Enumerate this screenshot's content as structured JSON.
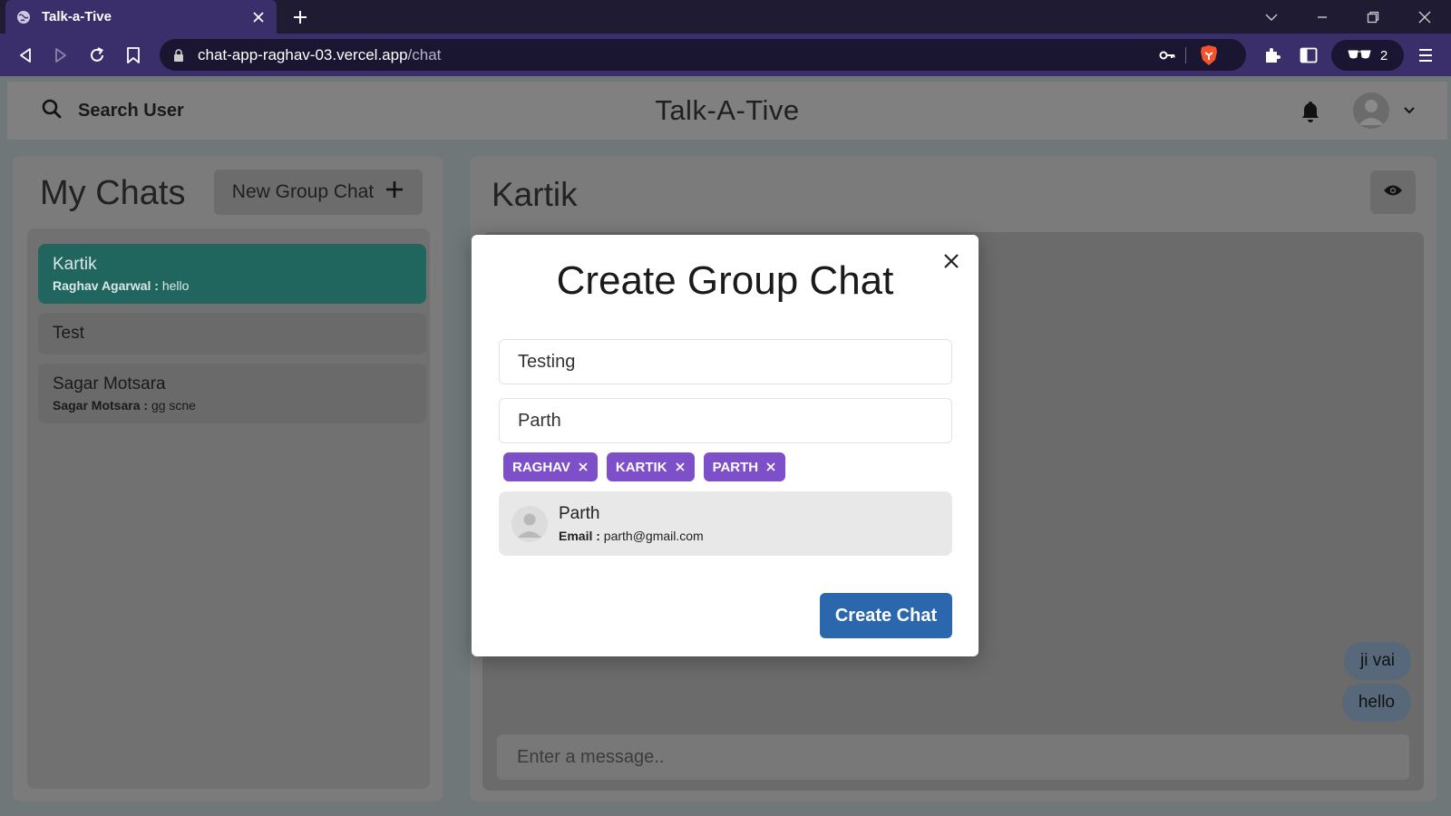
{
  "browser": {
    "tab_title": "Talk-a-Tive",
    "url_host": "chat-app-raghav-03.vercel.app",
    "url_path": "/chat",
    "vpn_count": "2"
  },
  "header": {
    "search_label": "Search User",
    "app_title": "Talk-A-Tive"
  },
  "sidebar": {
    "title": "My Chats",
    "new_group_label": "New Group Chat",
    "chats": [
      {
        "name": "Kartik",
        "latest_sender": "Raghav Agarwal :",
        "latest_text": "hello",
        "active": true
      },
      {
        "name": "Test"
      },
      {
        "name": "Sagar Motsara",
        "latest_sender": "Sagar Motsara :",
        "latest_text": "gg scne"
      }
    ]
  },
  "chat": {
    "name": "Kartik",
    "messages": [
      "ji vai",
      "hello"
    ],
    "input_placeholder": "Enter a message.."
  },
  "modal": {
    "title": "Create Group Chat",
    "chat_name_value": "Testing",
    "search_value": "Parth",
    "selected_users": [
      "RAGHAV",
      "KARTIK",
      "PARTH"
    ],
    "result": {
      "name": "Parth",
      "email_label": "Email :",
      "email": "parth@gmail.com"
    },
    "create_label": "Create Chat"
  },
  "colors": {
    "active_chat": "#20665f",
    "tag": "#7d4fc9",
    "create_button": "#2b67ad",
    "browser_toolbar": "#3a2f6b"
  }
}
